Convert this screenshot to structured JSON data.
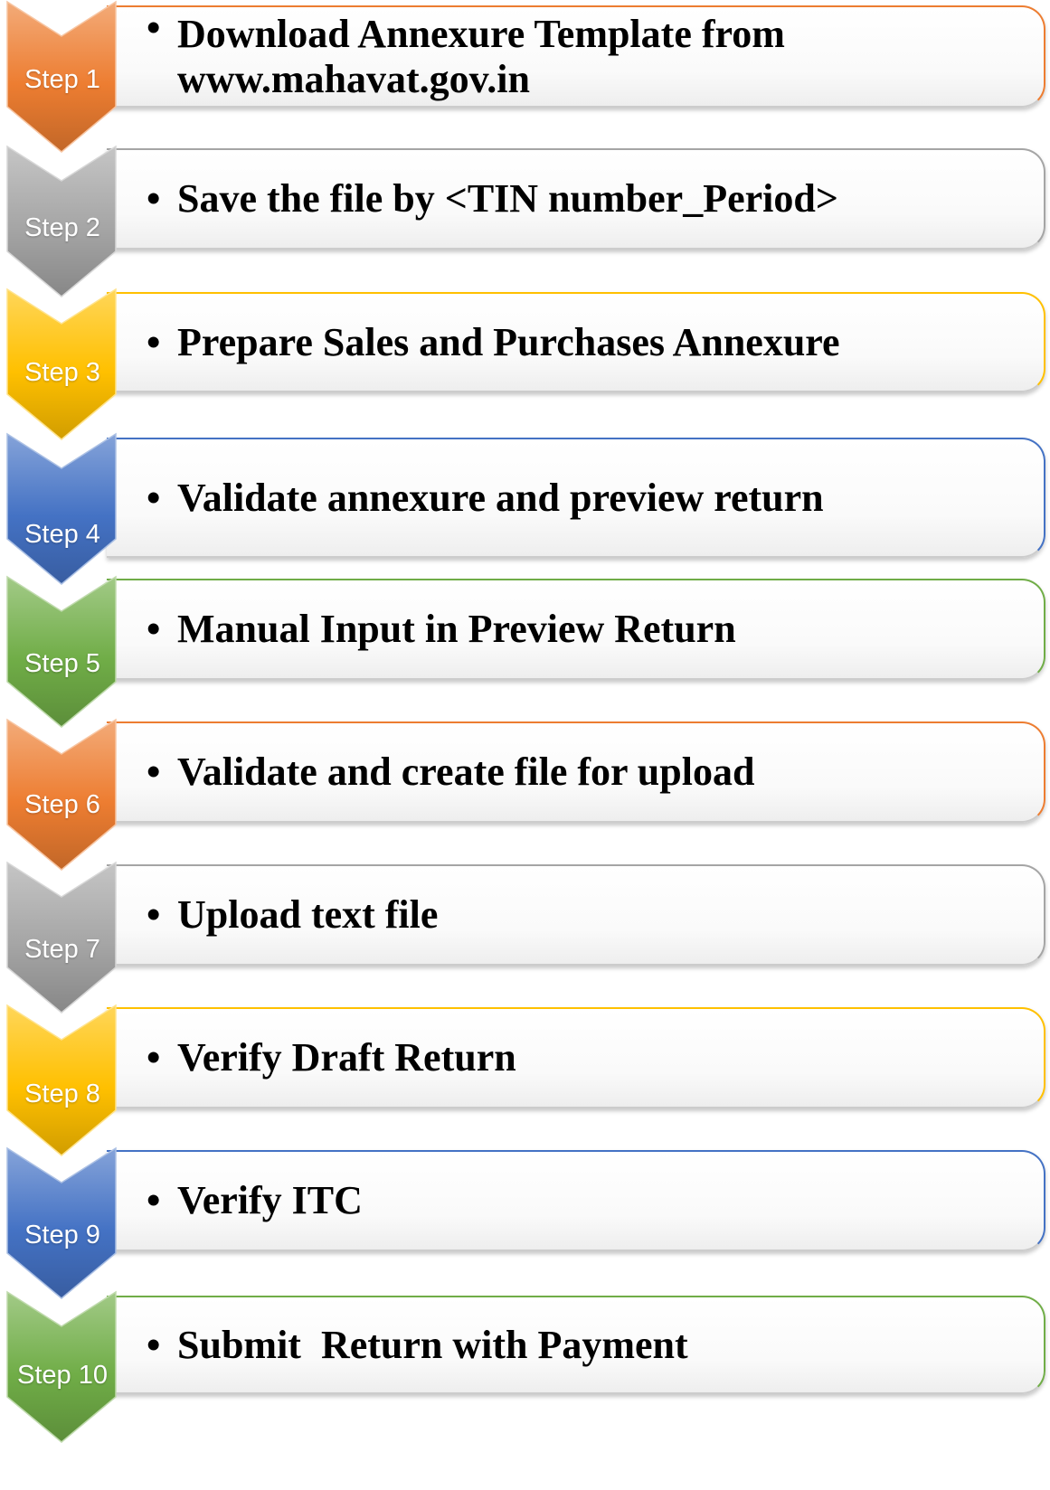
{
  "steps": [
    {
      "label": "Step 1",
      "bullet": "•",
      "lines": [
        "Download Annexure Template from",
        "www.mahavat.gov.in"
      ],
      "color": "#ED7D31"
    },
    {
      "label": "Step 2",
      "bullet": "•",
      "lines": [
        "Save the file by <TIN number_Period>"
      ],
      "color": "#A5A5A5"
    },
    {
      "label": "Step 3",
      "bullet": "•",
      "lines": [
        "Prepare Sales and Purchases Annexure"
      ],
      "color": "#FFC000"
    },
    {
      "label": "Step 4",
      "bullet": "•",
      "lines": [
        "Validate annexure and preview return"
      ],
      "color": "#4472C4"
    },
    {
      "label": "Step 5",
      "bullet": "•",
      "lines": [
        "Manual Input in Preview Return"
      ],
      "color": "#70AD47"
    },
    {
      "label": "Step 6",
      "bullet": "•",
      "lines": [
        "Validate and create file for upload"
      ],
      "color": "#ED7D31"
    },
    {
      "label": "Step 7",
      "bullet": "•",
      "lines": [
        "Upload text file"
      ],
      "color": "#A5A5A5"
    },
    {
      "label": "Step 8",
      "bullet": "•",
      "lines": [
        "Verify Draft Return"
      ],
      "color": "#FFC000"
    },
    {
      "label": "Step 9",
      "bullet": "•",
      "lines": [
        "Verify ITC"
      ],
      "color": "#4472C4"
    },
    {
      "label": "Step 10",
      "bullet": "•",
      "lines": [
        "Submit  Return with Payment"
      ],
      "color": "#70AD47"
    }
  ]
}
